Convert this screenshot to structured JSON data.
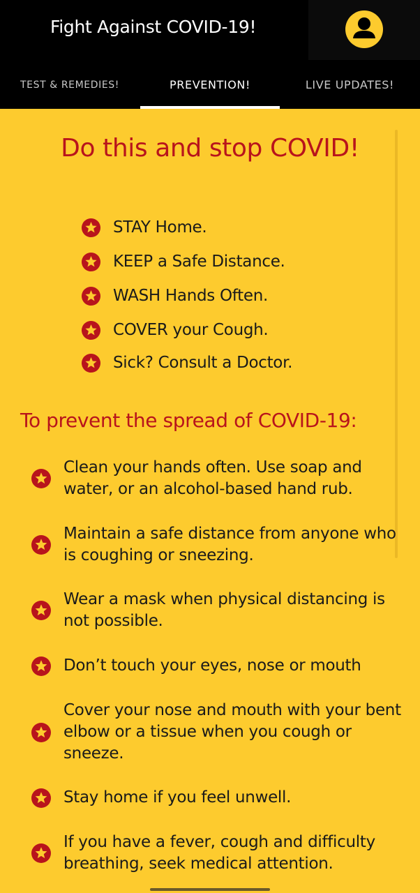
{
  "app_bar": {
    "title": "Fight Against COVID-19!",
    "avatar_icon": "account-circle-icon",
    "avatar_color": "#FDCB2E"
  },
  "tabs": [
    {
      "label": "TEST & REMEDIES!",
      "selected": false
    },
    {
      "label": "PREVENTION!",
      "selected": true
    },
    {
      "label": "LIVE UPDATES!",
      "selected": false
    }
  ],
  "colors": {
    "background": "#FDCB2E",
    "accent_red": "#B8141C",
    "bar": "#000000"
  },
  "main": {
    "heading": "Do this and stop COVID!",
    "rules": [
      {
        "icon": "star-circle-icon",
        "text": "STAY Home."
      },
      {
        "icon": "star-circle-icon",
        "text": "KEEP a Safe Distance."
      },
      {
        "icon": "star-circle-icon",
        "text": "WASH Hands Often."
      },
      {
        "icon": "star-circle-icon",
        "text": "COVER your Cough."
      },
      {
        "icon": "star-circle-icon",
        "text": "Sick? Consult a Doctor."
      }
    ],
    "subheading": "To prevent the spread of COVID-19:",
    "tips": [
      {
        "icon": "star-circle-icon",
        "text": "Clean your hands often. Use soap and water, or an alcohol-based hand rub."
      },
      {
        "icon": "star-circle-icon",
        "text": "Maintain a safe distance from anyone who is coughing or sneezing."
      },
      {
        "icon": "star-circle-icon",
        "text": "Wear a mask when physical distancing is not possible."
      },
      {
        "icon": "star-circle-icon",
        "text": "Don’t touch your eyes, nose or mouth"
      },
      {
        "icon": "star-circle-icon",
        "text": "Cover your nose and mouth with your bent elbow or a tissue when you cough or sneeze."
      },
      {
        "icon": "star-circle-icon",
        "text": "Stay home if you feel unwell."
      },
      {
        "icon": "star-circle-icon",
        "text": "If you have a fever, cough and difficulty breathing, seek medical attention."
      }
    ]
  }
}
